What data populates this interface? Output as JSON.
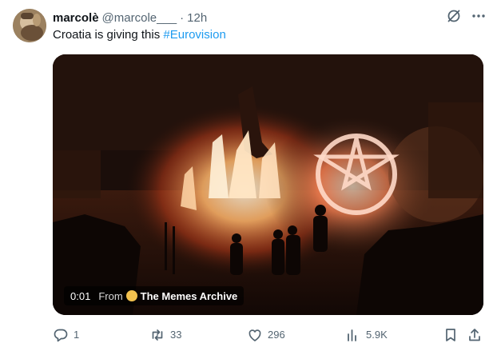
{
  "author": {
    "display_name": "marcolè",
    "handle": "@marcole___",
    "separator": "·",
    "time": "12h"
  },
  "tweet": {
    "text": "Croatia is giving this ",
    "hashtag": "#Eurovision"
  },
  "video": {
    "time": "0:01",
    "from_label": "From",
    "source_name": "The Memes Archive"
  },
  "actions": {
    "replies": "1",
    "reposts": "33",
    "likes": "296",
    "views": "5.9K"
  },
  "colors": {
    "accent": "#1d9bf0",
    "secondary_text": "#536471",
    "primary_text": "#0f1419"
  },
  "icons": [
    "grok-icon",
    "more-icon",
    "reply-icon",
    "repost-icon",
    "like-icon",
    "views-icon",
    "bookmark-icon",
    "share-icon"
  ]
}
